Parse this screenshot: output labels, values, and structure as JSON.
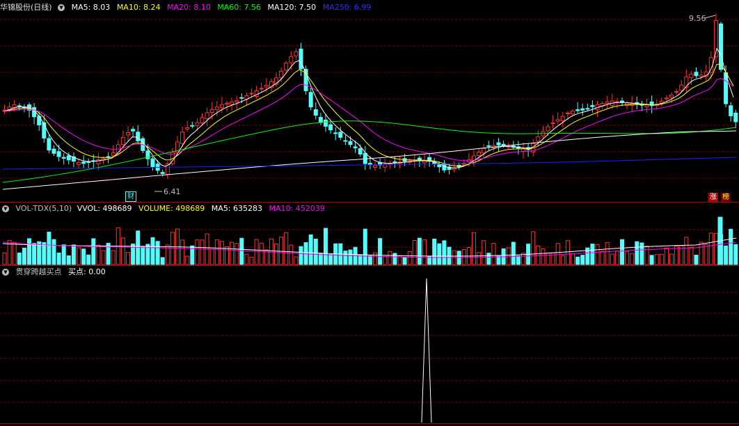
{
  "main": {
    "title": "华锦股份(日线)",
    "circle_icon_label": "▼",
    "ma": [
      {
        "label": "MA5: 8.03",
        "color": "#ffffff"
      },
      {
        "label": "MA10: 8.24",
        "color": "#ffff00"
      },
      {
        "label": "MA20: 8.10",
        "color": "#ff00ff"
      },
      {
        "label": "MA60: 7.56",
        "color": "#00ff00"
      },
      {
        "label": "MA120: 7.50",
        "color": "#ffffff"
      },
      {
        "label": "MA250: 6.99",
        "color": "#2020ff"
      }
    ],
    "high_label": "9.56",
    "low_label": "6.41",
    "fin_tag": "财",
    "zt_tag": "涨",
    "bang_tag": "榜"
  },
  "volume": {
    "title": "VOL-TDX(5,10)",
    "items": [
      {
        "label": "VVOL: 498689",
        "color": "#ffffff"
      },
      {
        "label": "VOLUME: 498689",
        "color": "#ffff00"
      },
      {
        "label": "MA5: 635283",
        "color": "#ffffff"
      },
      {
        "label": "MA10: 452039",
        "color": "#ff00ff"
      }
    ]
  },
  "indicator": {
    "title": "贯穿跨越买点",
    "value_label": "买点: 0.00"
  },
  "colors": {
    "up": "#ff3232",
    "down": "#54fcfc",
    "grid": "#7a0000",
    "ma5": "#ffffff",
    "ma10": "#ffff00",
    "ma20": "#ff00ff",
    "ma60": "#00ff00",
    "ma120": "#ffffff",
    "ma250": "#2020ff"
  }
}
